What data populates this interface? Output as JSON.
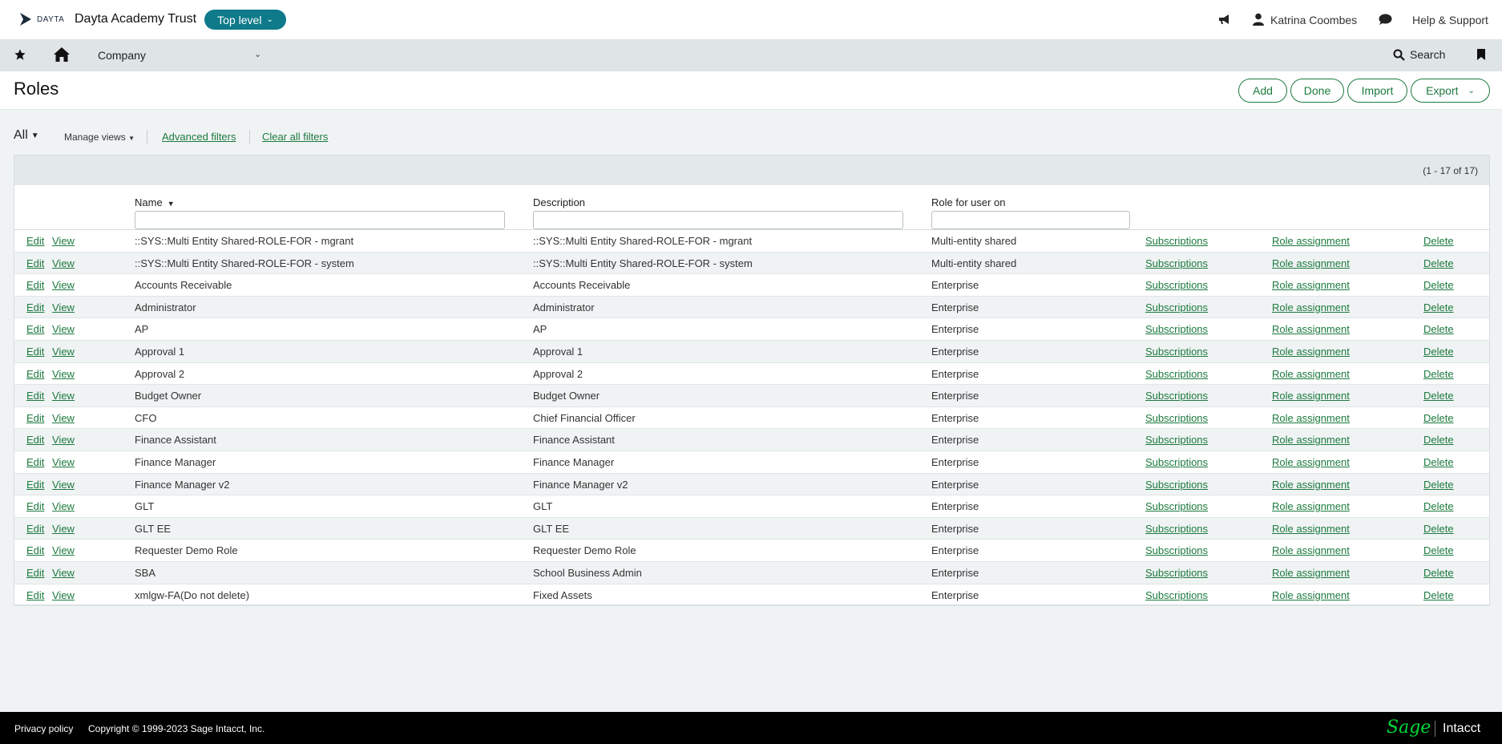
{
  "header": {
    "logo_text": "DAYTA",
    "company_name": "Dayta Academy Trust",
    "level": "Top level",
    "user_name": "Katrina Coombes",
    "help": "Help & Support"
  },
  "nav": {
    "company": "Company",
    "search": "Search"
  },
  "page": {
    "title": "Roles",
    "buttons": {
      "add": "Add",
      "done": "Done",
      "import": "Import",
      "export": "Export"
    }
  },
  "filters": {
    "view": "All",
    "manage_views": "Manage views",
    "advanced": "Advanced filters",
    "clear": "Clear all filters"
  },
  "table": {
    "count": "(1 - 17 of 17)",
    "columns": {
      "name": "Name",
      "description": "Description",
      "role_for": "Role for user on"
    },
    "actions": {
      "edit": "Edit",
      "view": "View",
      "subscriptions": "Subscriptions",
      "role_assignment": "Role assignment",
      "delete": "Delete"
    },
    "rows": [
      {
        "name": "::SYS::Multi Entity Shared-ROLE-FOR - mgrant",
        "description": "::SYS::Multi Entity Shared-ROLE-FOR - mgrant",
        "role_for": "Multi-entity shared"
      },
      {
        "name": "::SYS::Multi Entity Shared-ROLE-FOR - system",
        "description": "::SYS::Multi Entity Shared-ROLE-FOR - system",
        "role_for": "Multi-entity shared"
      },
      {
        "name": "Accounts Receivable",
        "description": "Accounts Receivable",
        "role_for": "Enterprise"
      },
      {
        "name": "Administrator",
        "description": "Administrator",
        "role_for": "Enterprise"
      },
      {
        "name": "AP",
        "description": "AP",
        "role_for": "Enterprise"
      },
      {
        "name": "Approval 1",
        "description": "Approval 1",
        "role_for": "Enterprise"
      },
      {
        "name": "Approval 2",
        "description": "Approval 2",
        "role_for": "Enterprise"
      },
      {
        "name": "Budget Owner",
        "description": "Budget Owner",
        "role_for": "Enterprise"
      },
      {
        "name": "CFO",
        "description": "Chief Financial Officer",
        "role_for": "Enterprise"
      },
      {
        "name": "Finance Assistant",
        "description": "Finance Assistant",
        "role_for": "Enterprise"
      },
      {
        "name": "Finance Manager",
        "description": "Finance Manager",
        "role_for": "Enterprise"
      },
      {
        "name": "Finance Manager v2",
        "description": "Finance Manager v2",
        "role_for": "Enterprise"
      },
      {
        "name": "GLT",
        "description": "GLT",
        "role_for": "Enterprise"
      },
      {
        "name": "GLT EE",
        "description": "GLT EE",
        "role_for": "Enterprise"
      },
      {
        "name": "Requester Demo Role",
        "description": "Requester Demo Role",
        "role_for": "Enterprise"
      },
      {
        "name": "SBA",
        "description": "School Business Admin",
        "role_for": "Enterprise"
      },
      {
        "name": "xmlgw-FA(Do not delete)",
        "description": "Fixed Assets",
        "role_for": "Enterprise"
      }
    ]
  },
  "footer": {
    "privacy": "Privacy policy",
    "copyright": "Copyright © 1999-2023 Sage Intacct, Inc.",
    "brand_sage": "Sage",
    "brand_intacct": "Intacct"
  },
  "colors": {
    "accent_green": "#1c7a3e",
    "pill_teal": "#0e7a8a",
    "brand_green": "#00d639"
  }
}
